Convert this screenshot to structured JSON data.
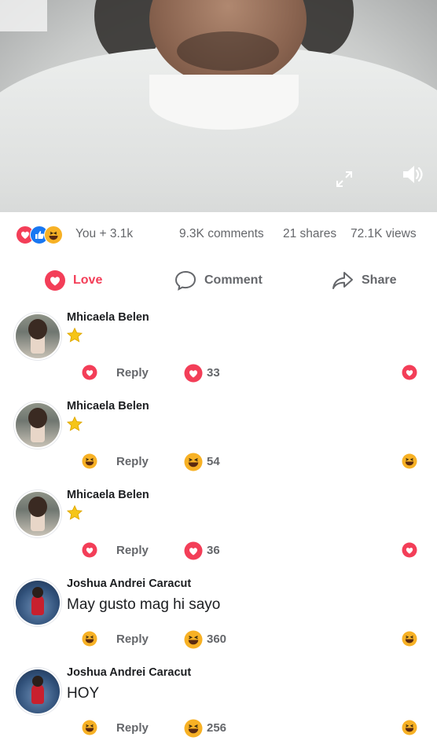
{
  "video": {
    "expand_icon": "expand-arrows-icon",
    "volume_icon": "volume-on-icon"
  },
  "stats": {
    "reactions": [
      "love",
      "like",
      "haha"
    ],
    "you_count": "You + 3.1k",
    "comments": "9.3K comments",
    "shares": "21 shares",
    "views": "72.1K views"
  },
  "actions": {
    "love": "Love",
    "comment": "Comment",
    "share": "Share"
  },
  "comments": [
    {
      "name": "Mhicaela Belen",
      "text": "",
      "sticker": "star",
      "reply": "Reply",
      "reaction": "love",
      "count": "33"
    },
    {
      "name": "Mhicaela Belen",
      "text": "",
      "sticker": "star",
      "reply": "Reply",
      "reaction": "haha",
      "count": "54"
    },
    {
      "name": "Mhicaela Belen",
      "text": "",
      "sticker": "star",
      "reply": "Reply",
      "reaction": "love",
      "count": "36"
    },
    {
      "name": "Joshua Andrei Caracut",
      "text": "May gusto mag hi sayo",
      "sticker": "",
      "reply": "Reply",
      "reaction": "haha",
      "count": "360"
    },
    {
      "name": "Joshua Andrei Caracut",
      "text": "HOY",
      "sticker": "",
      "reply": "Reply",
      "reaction": "haha",
      "count": "256"
    }
  ],
  "colors": {
    "love": "#f33e58",
    "like": "#1877f2",
    "haha": "#f7b125",
    "meta_text": "#65676b"
  }
}
